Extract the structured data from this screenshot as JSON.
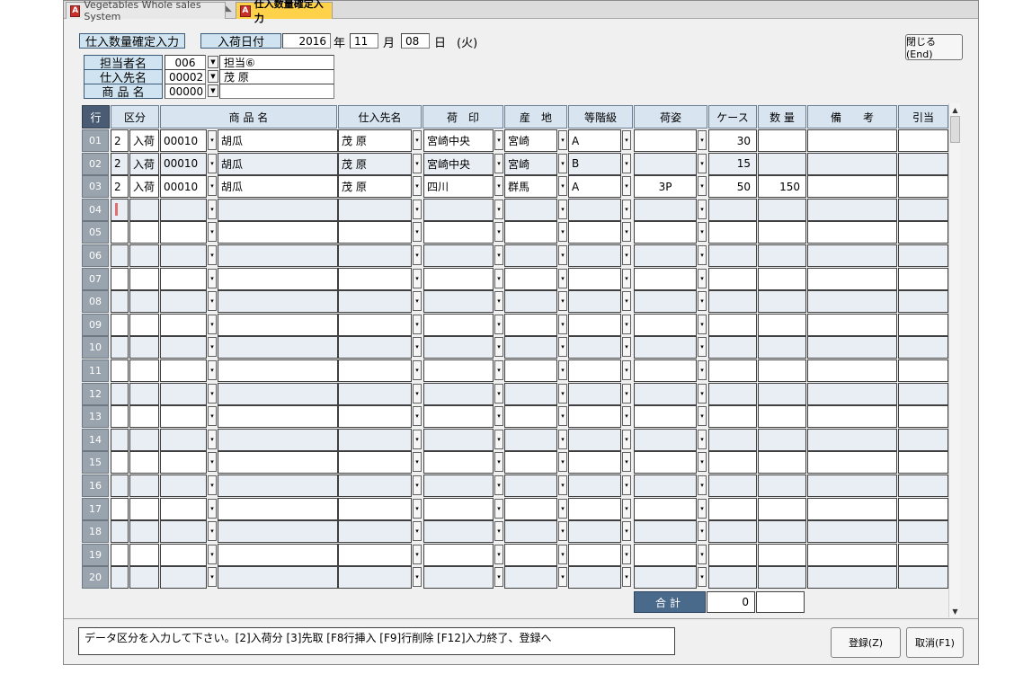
{
  "tabs": [
    {
      "label": "Vegetables Whole sales System",
      "icon": "app-icon",
      "active": false
    },
    {
      "label": "仕入数量確定入力",
      "icon": "app-icon",
      "active": true
    }
  ],
  "form": {
    "screen_title": "仕入数量確定入力",
    "date_label": "入荷日付",
    "year_value": "2016",
    "year_unit": "年",
    "month_value": "11",
    "month_unit": "月",
    "day_value": "08",
    "day_unit": "日",
    "weekday": "(火)",
    "staff_label": "担当者名",
    "staff_code": "006",
    "staff_name": "担当⑥",
    "supplier_label": "仕入先名",
    "supplier_code": "00002",
    "supplier_name": "茂 原",
    "product_label": "商 品 名",
    "product_code": "00000",
    "product_name": ""
  },
  "buttons": {
    "close": "閉じる(End)",
    "register": "登録(Z)",
    "cancel": "取消(F1)"
  },
  "grid": {
    "columns": [
      "行",
      "区分",
      "商 品 名",
      "仕入先名",
      "荷　印",
      "産　地",
      "等階級",
      "荷姿",
      "ケース",
      "数 量",
      "備　　考",
      "引当"
    ],
    "rows": [
      {
        "no": "01",
        "kubun_code": "2",
        "kubun": "入荷",
        "code": "00010",
        "product": "胡瓜",
        "supplier": "茂 原",
        "mark": "宮崎中央",
        "origin": "宮崎",
        "grade": "A",
        "packing": "",
        "cases": "30",
        "qty": "",
        "note": "",
        "alloc": ""
      },
      {
        "no": "02",
        "kubun_code": "2",
        "kubun": "入荷",
        "code": "00010",
        "product": "胡瓜",
        "supplier": "茂 原",
        "mark": "宮崎中央",
        "origin": "宮崎",
        "grade": "B",
        "packing": "",
        "cases": "15",
        "qty": "",
        "note": "",
        "alloc": ""
      },
      {
        "no": "03",
        "kubun_code": "2",
        "kubun": "入荷",
        "code": "00010",
        "product": "胡瓜",
        "supplier": "茂 原",
        "mark": "四川",
        "origin": "群馬",
        "grade": "A",
        "packing": "3P",
        "cases": "50",
        "qty": "150",
        "note": "",
        "alloc": ""
      },
      {
        "no": "04",
        "kubun_code": "",
        "kubun": "",
        "code": "",
        "product": "",
        "supplier": "",
        "mark": "",
        "origin": "",
        "grade": "",
        "packing": "",
        "cases": "",
        "qty": "",
        "note": "",
        "alloc": ""
      },
      {
        "no": "05",
        "kubun_code": "",
        "kubun": "",
        "code": "",
        "product": "",
        "supplier": "",
        "mark": "",
        "origin": "",
        "grade": "",
        "packing": "",
        "cases": "",
        "qty": "",
        "note": "",
        "alloc": ""
      },
      {
        "no": "06",
        "kubun_code": "",
        "kubun": "",
        "code": "",
        "product": "",
        "supplier": "",
        "mark": "",
        "origin": "",
        "grade": "",
        "packing": "",
        "cases": "",
        "qty": "",
        "note": "",
        "alloc": ""
      },
      {
        "no": "07",
        "kubun_code": "",
        "kubun": "",
        "code": "",
        "product": "",
        "supplier": "",
        "mark": "",
        "origin": "",
        "grade": "",
        "packing": "",
        "cases": "",
        "qty": "",
        "note": "",
        "alloc": ""
      },
      {
        "no": "08",
        "kubun_code": "",
        "kubun": "",
        "code": "",
        "product": "",
        "supplier": "",
        "mark": "",
        "origin": "",
        "grade": "",
        "packing": "",
        "cases": "",
        "qty": "",
        "note": "",
        "alloc": ""
      },
      {
        "no": "09",
        "kubun_code": "",
        "kubun": "",
        "code": "",
        "product": "",
        "supplier": "",
        "mark": "",
        "origin": "",
        "grade": "",
        "packing": "",
        "cases": "",
        "qty": "",
        "note": "",
        "alloc": ""
      },
      {
        "no": "10",
        "kubun_code": "",
        "kubun": "",
        "code": "",
        "product": "",
        "supplier": "",
        "mark": "",
        "origin": "",
        "grade": "",
        "packing": "",
        "cases": "",
        "qty": "",
        "note": "",
        "alloc": ""
      },
      {
        "no": "11",
        "kubun_code": "",
        "kubun": "",
        "code": "",
        "product": "",
        "supplier": "",
        "mark": "",
        "origin": "",
        "grade": "",
        "packing": "",
        "cases": "",
        "qty": "",
        "note": "",
        "alloc": ""
      },
      {
        "no": "12",
        "kubun_code": "",
        "kubun": "",
        "code": "",
        "product": "",
        "supplier": "",
        "mark": "",
        "origin": "",
        "grade": "",
        "packing": "",
        "cases": "",
        "qty": "",
        "note": "",
        "alloc": ""
      },
      {
        "no": "13",
        "kubun_code": "",
        "kubun": "",
        "code": "",
        "product": "",
        "supplier": "",
        "mark": "",
        "origin": "",
        "grade": "",
        "packing": "",
        "cases": "",
        "qty": "",
        "note": "",
        "alloc": ""
      },
      {
        "no": "14",
        "kubun_code": "",
        "kubun": "",
        "code": "",
        "product": "",
        "supplier": "",
        "mark": "",
        "origin": "",
        "grade": "",
        "packing": "",
        "cases": "",
        "qty": "",
        "note": "",
        "alloc": ""
      },
      {
        "no": "15",
        "kubun_code": "",
        "kubun": "",
        "code": "",
        "product": "",
        "supplier": "",
        "mark": "",
        "origin": "",
        "grade": "",
        "packing": "",
        "cases": "",
        "qty": "",
        "note": "",
        "alloc": ""
      },
      {
        "no": "16",
        "kubun_code": "",
        "kubun": "",
        "code": "",
        "product": "",
        "supplier": "",
        "mark": "",
        "origin": "",
        "grade": "",
        "packing": "",
        "cases": "",
        "qty": "",
        "note": "",
        "alloc": ""
      },
      {
        "no": "17",
        "kubun_code": "",
        "kubun": "",
        "code": "",
        "product": "",
        "supplier": "",
        "mark": "",
        "origin": "",
        "grade": "",
        "packing": "",
        "cases": "",
        "qty": "",
        "note": "",
        "alloc": ""
      },
      {
        "no": "18",
        "kubun_code": "",
        "kubun": "",
        "code": "",
        "product": "",
        "supplier": "",
        "mark": "",
        "origin": "",
        "grade": "",
        "packing": "",
        "cases": "",
        "qty": "",
        "note": "",
        "alloc": ""
      },
      {
        "no": "19",
        "kubun_code": "",
        "kubun": "",
        "code": "",
        "product": "",
        "supplier": "",
        "mark": "",
        "origin": "",
        "grade": "",
        "packing": "",
        "cases": "",
        "qty": "",
        "note": "",
        "alloc": ""
      },
      {
        "no": "20",
        "kubun_code": "",
        "kubun": "",
        "code": "",
        "product": "",
        "supplier": "",
        "mark": "",
        "origin": "",
        "grade": "",
        "packing": "",
        "cases": "",
        "qty": "",
        "note": "",
        "alloc": ""
      }
    ]
  },
  "totals": {
    "label": "合計",
    "cases_total": "0",
    "qty_total": ""
  },
  "status_message": "データ区分を入力して下さい。[2]入荷分 [3]先取 [F8行挿入 [F9]行削除 [F12]入力終了、登録へ",
  "colors": {
    "header_bg": "#d8e4f0",
    "row_number_bg": "#9aa4ae",
    "total_label_bg": "#4a6a8c",
    "active_tab": "#ffd24a"
  }
}
